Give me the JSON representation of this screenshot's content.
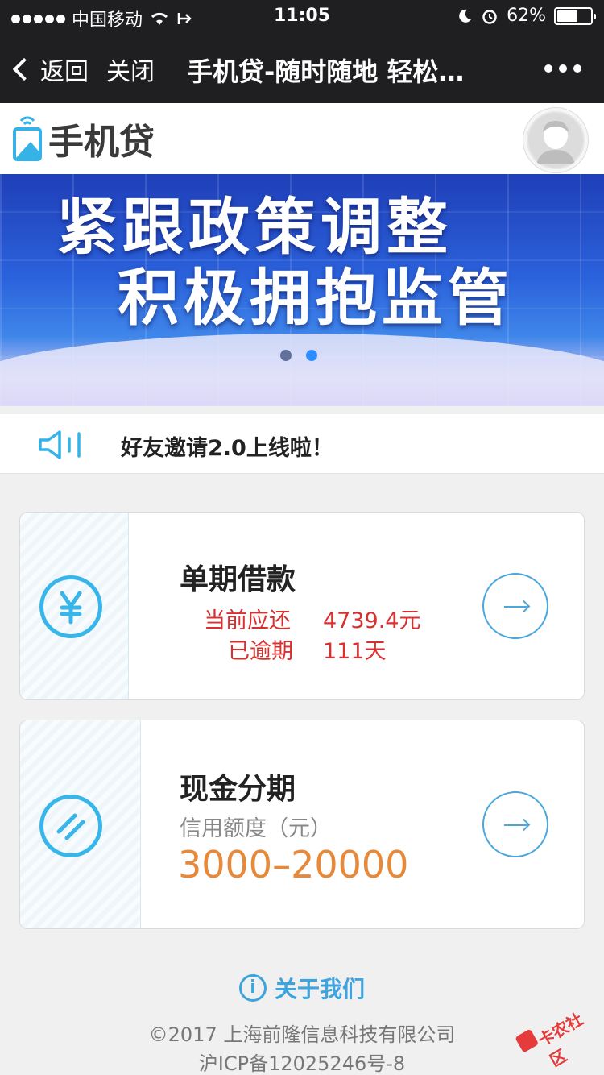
{
  "status_bar": {
    "carrier": "中国移动",
    "time": "11:05",
    "battery_percent": "62%",
    "battery_level": 0.62
  },
  "nav": {
    "back_label": "返回",
    "close_label": "关闭",
    "title": "手机贷-随时随地 轻松…"
  },
  "app": {
    "logo_text": "手机贷"
  },
  "banner": {
    "line1": "紧跟政策调整",
    "line2": "积极拥抱监管",
    "active_slide": 2,
    "slide_count": 2
  },
  "notice": {
    "text": "好友邀请2.0上线啦！"
  },
  "loan_card": {
    "title": "单期借款",
    "due_label": "当前应还",
    "due_value": "4739.4元",
    "overdue_label": "已逾期",
    "overdue_value": "111天"
  },
  "installment_card": {
    "title": "现金分期",
    "credit_label": "信用额度（元）",
    "credit_range": "3000–20000"
  },
  "footer": {
    "about_label": "关于我们",
    "copyright": "©2017 上海前隆信息科技有限公司",
    "icp": "沪ICP备12025246号-8"
  },
  "watermark": {
    "text": "卡农社区"
  },
  "colors": {
    "nav_bg": "#1f1f21",
    "accent_blue": "#38b6ea",
    "link_blue": "#3ea4dd",
    "alert_red": "#d9302f",
    "amount_orange": "#e6893a"
  }
}
